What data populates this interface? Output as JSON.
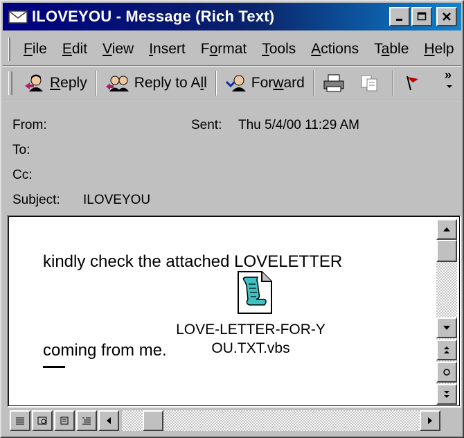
{
  "window": {
    "title": "ILOVEYOU - Message (Rich Text)"
  },
  "menu": [
    {
      "pre": "",
      "u": "F",
      "post": "ile"
    },
    {
      "pre": "",
      "u": "E",
      "post": "dit"
    },
    {
      "pre": "",
      "u": "V",
      "post": "iew"
    },
    {
      "pre": "",
      "u": "I",
      "post": "nsert"
    },
    {
      "pre": "F",
      "u": "o",
      "post": "rmat"
    },
    {
      "pre": "",
      "u": "T",
      "post": "ools"
    },
    {
      "pre": "",
      "u": "A",
      "post": "ctions"
    },
    {
      "pre": "T",
      "u": "a",
      "post": "ble"
    },
    {
      "pre": "",
      "u": "H",
      "post": "elp"
    }
  ],
  "toolbar": {
    "reply": {
      "pre": "",
      "u": "R",
      "post": "eply"
    },
    "reply_all": {
      "pre": "Reply to A",
      "u": "l",
      "post": "l"
    },
    "forward": {
      "pre": "For",
      "u": "w",
      "post": "ard"
    },
    "more": "»"
  },
  "header": {
    "from_label": "From:",
    "sent_label": "Sent:",
    "sent_value": "Thu 5/4/00 11:29 AM",
    "to_label": "To:",
    "cc_label": "Cc:",
    "subject_label": "Subject:",
    "subject_value": "ILOVEYOU"
  },
  "body": {
    "line1": "kindly check the attached LOVELETTER",
    "line2": "coming from me.",
    "attachment_line1": "LOVE-LETTER-FOR-Y",
    "attachment_line2": "OU.TXT.vbs"
  },
  "icons": {
    "title": "envelope-icon",
    "reply": "reply-icon",
    "reply_all": "reply-all-icon",
    "forward": "forward-icon",
    "print": "print-icon",
    "copy": "copy-icon",
    "flag": "flag-icon",
    "attachment": "script-file-icon"
  },
  "colors": {
    "titlebar_start": "#000080",
    "titlebar_end": "#1084d0",
    "flag": "#c00000"
  }
}
